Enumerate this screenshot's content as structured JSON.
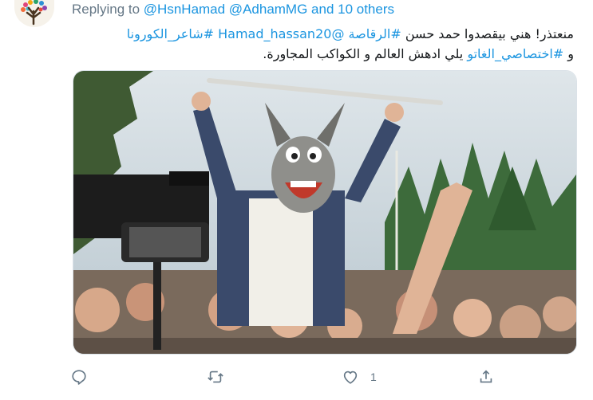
{
  "reply_header": {
    "prefix": "Replying to",
    "mentions": "@HsnHamad @AdhamMG and 10 others"
  },
  "tweet": {
    "line1_plain_start": "منعتذر!  هني بيقصدوا حمد حسن ",
    "line1_tag1": "#الرقاصة",
    "line1_sep1": " ",
    "line1_mention": "@Hamad_hassan20",
    "line1_sep2": " ",
    "line1_tag2": "#شاعر_الكورونا",
    "line2_plain_start": "و ",
    "line2_tag": "#اختصاصي_الغاتو",
    "line2_plain_end": " يلي ادهش العالم و الكواكب المجاورة."
  },
  "media": {
    "description_icon": "photo",
    "accent_sky": "#c9d6df",
    "accent_jacket": "#3a4a6b",
    "accent_donkey": "#8f8f8b"
  },
  "actions": {
    "reply_icon": "reply-icon",
    "retweet_icon": "retweet-icon",
    "like_icon": "heart-icon",
    "like_count": "1",
    "share_icon": "share-icon"
  }
}
